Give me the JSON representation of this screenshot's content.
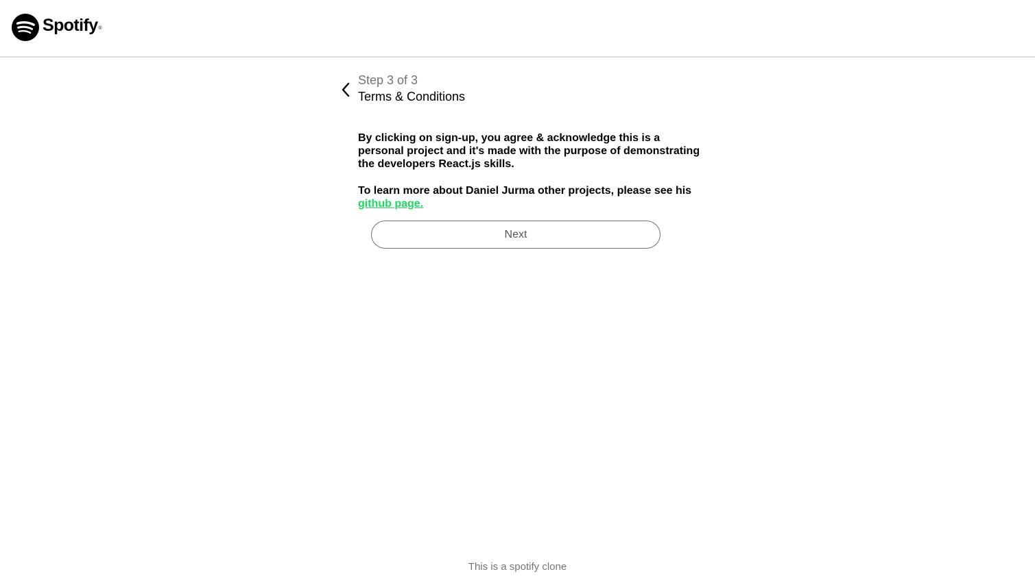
{
  "header": {
    "logo": {
      "icon": "spotify-logo-icon",
      "wordmark": "Spotify",
      "registered_mark": "®"
    }
  },
  "stepper": {
    "back_icon": "chevron-left-icon",
    "step_count": "Step 3 of 3",
    "step_title": "Terms & Conditions"
  },
  "content": {
    "paragraph1": "By clicking on sign-up, you agree & acknowledge this is a personal project and it's made with the purpose of demonstrating the developers React.js skills.",
    "paragraph2_text": "To learn more about Daniel Jurma other projects, please see his",
    "link_label": "github page."
  },
  "actions": {
    "next_label": "Next"
  },
  "footer": {
    "text": "This is a spotify clone"
  },
  "colors": {
    "accent": "#1ed760",
    "muted_text": "#757575",
    "divider": "#dcdcdc"
  }
}
